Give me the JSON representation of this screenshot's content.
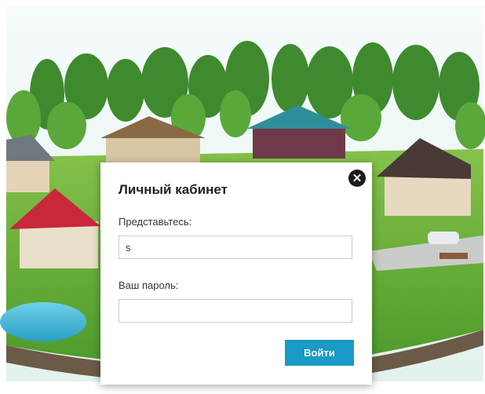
{
  "dialog": {
    "title": "Личный кабинет",
    "close_icon": "close-x-icon",
    "name_label": "Представьтесь:",
    "name_value": "s",
    "password_label": "Ваш пароль:",
    "password_value": "",
    "submit_label": "Войти"
  },
  "colors": {
    "accent": "#1a9ac6",
    "close": "#1a1a1a"
  }
}
